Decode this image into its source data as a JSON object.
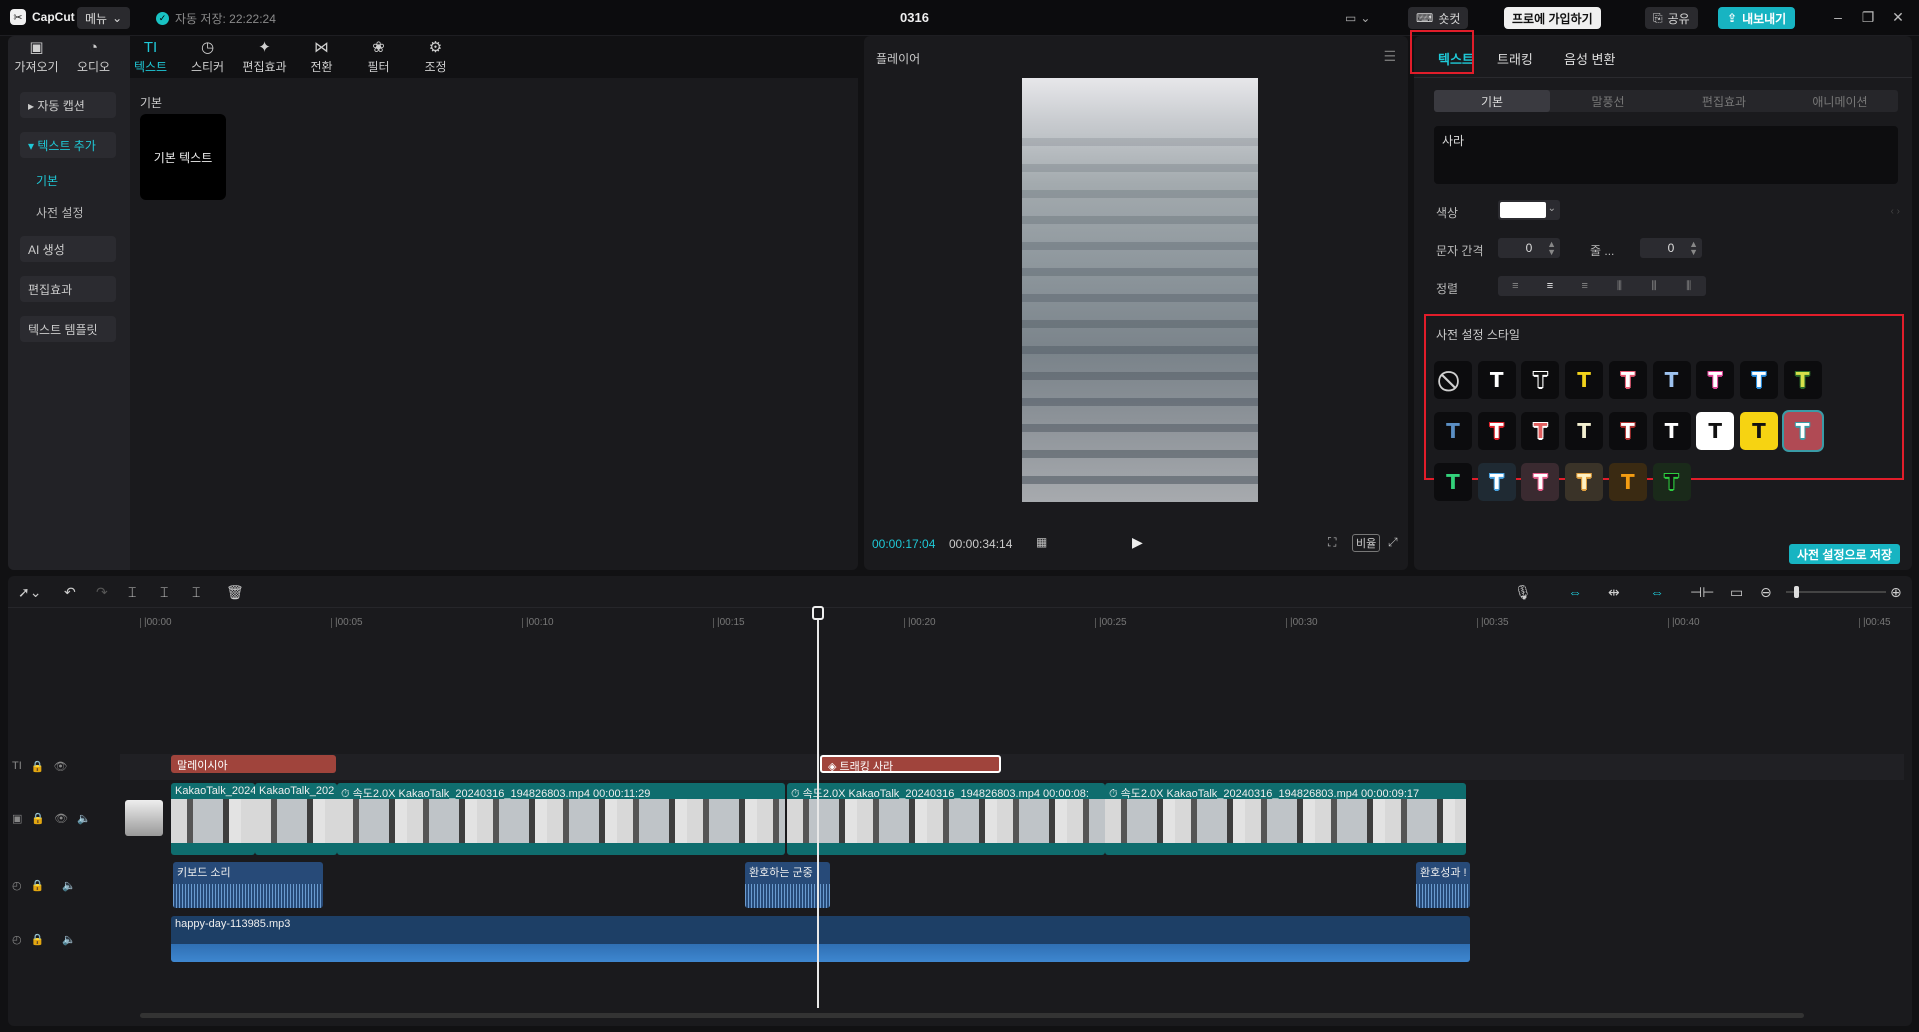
{
  "app": {
    "name": "CapCut",
    "menu_label": "메뉴",
    "autosave": "자동 저장: 22:22:24",
    "project_title": "0316"
  },
  "titlebar": {
    "shortcut": "숏컷",
    "pro": "프로에 가입하기",
    "share": "공유",
    "export": "내보내기"
  },
  "tools": [
    {
      "label": "가져오기",
      "icon": "▣"
    },
    {
      "label": "오디오",
      "icon": "◔"
    },
    {
      "label": "텍스트",
      "icon": "TI"
    },
    {
      "label": "스티커",
      "icon": "◷"
    },
    {
      "label": "편집효과",
      "icon": "✦"
    },
    {
      "label": "전환",
      "icon": "⋈"
    },
    {
      "label": "필터",
      "icon": "❀"
    },
    {
      "label": "조정",
      "icon": "⚙"
    }
  ],
  "leftnav": {
    "auto_caption": "▸ 자동 캡션",
    "add_text": "▾ 텍스트 추가",
    "sub_basic": "기본",
    "sub_preset": "사전 설정",
    "ai_generate": "AI 생성",
    "effects": "편집효과",
    "templates": "텍스트 템플릿"
  },
  "leftpanel": {
    "section": "기본",
    "card": "기본 텍스트"
  },
  "player": {
    "title": "플레이어",
    "time_current": "00:00:17:04",
    "time_total": "00:00:34:14",
    "ratio": "비율"
  },
  "right": {
    "tabs": [
      "텍스트",
      "트래킹",
      "음성 변환"
    ],
    "subtabs": [
      "기본",
      "말풍선",
      "편집효과",
      "애니메이션"
    ],
    "text_value": "사라",
    "color_label": "색상",
    "spacing_label": "문자 간격",
    "spacing_value": "0",
    "line_label": "줄 ...",
    "line_value": "0",
    "align_label": "정렬",
    "presets_title": "사전 설정 스타일",
    "save_preset": "사전 설정으로 저장"
  },
  "presets": [
    {
      "glyph": "⃠",
      "fg": "#d0d0d0",
      "bg": "#0c0c0e"
    },
    {
      "glyph": "T",
      "fg": "#ffffff",
      "bg": "#0c0c0e"
    },
    {
      "glyph": "T",
      "fg": "#111111",
      "bg": "#0c0c0e",
      "outline": "#ffffff"
    },
    {
      "glyph": "T",
      "fg": "#f2d31b",
      "bg": "#0c0c0e"
    },
    {
      "glyph": "T",
      "fg": "#ffffff",
      "bg": "#0c0c0e",
      "outline": "#e85d75"
    },
    {
      "glyph": "T",
      "fg": "#9ec3f0",
      "bg": "#0c0c0e"
    },
    {
      "glyph": "T",
      "fg": "#ffffff",
      "bg": "#0c0c0e",
      "outline": "#e24a9b"
    },
    {
      "glyph": "T",
      "fg": "#ffffff",
      "bg": "#0c0c0e",
      "outline": "#2a8fe0"
    },
    {
      "glyph": "T",
      "fg": "#d6e04a",
      "bg": "#0c0c0e",
      "outline": "#2a6b2a"
    },
    {
      "glyph": "T",
      "fg": "#5b8fc4",
      "bg": "#0c0c0e"
    },
    {
      "glyph": "T",
      "fg": "#ffffff",
      "bg": "#0c0c0e",
      "outline": "#e0202a"
    },
    {
      "glyph": "T",
      "fg": "#e26060",
      "bg": "#0c0c0e",
      "outline": "#ffffff"
    },
    {
      "glyph": "T",
      "fg": "#f3efd0",
      "bg": "#0c0c0e"
    },
    {
      "glyph": "T",
      "fg": "#ffffff",
      "bg": "#0c0c0e",
      "outline": "#b03030"
    },
    {
      "glyph": "T",
      "fg": "#ffffff",
      "bg": "#0c0c0e"
    },
    {
      "glyph": "T",
      "fg": "#111111",
      "bg": "#ffffff"
    },
    {
      "glyph": "T",
      "fg": "#111111",
      "bg": "#f6d312"
    },
    {
      "glyph": "T",
      "fg": "#ffffff",
      "bg": "#b04a54",
      "outline": "#3a9ba6"
    },
    {
      "glyph": "T",
      "fg": "#33d17a",
      "bg": "#0c0c0e"
    },
    {
      "glyph": "T",
      "fg": "#ffffff",
      "bg": "#1f2a33",
      "outline": "#4aa3e0"
    },
    {
      "glyph": "T",
      "fg": "#ffffff",
      "bg": "#3a2a30",
      "outline": "#e65c8a"
    },
    {
      "glyph": "T",
      "fg": "#fff1c2",
      "bg": "#3a3328",
      "outline": "#e0a040"
    },
    {
      "glyph": "T",
      "fg": "#f39c12",
      "bg": "#3a2a12"
    },
    {
      "glyph": "T",
      "fg": "#111111",
      "bg": "#1a2a1a",
      "outline": "#2ecc40"
    }
  ],
  "ruler": [
    "|00:00",
    "|00:05",
    "|00:10",
    "|00:15",
    "|00:20",
    "|00:25",
    "|00:30",
    "|00:35",
    "|00:40",
    "|00:45"
  ],
  "timeline": {
    "text_clips": [
      {
        "label": "말레이시아"
      },
      {
        "label": "◈ 트래킹  사라"
      }
    ],
    "video_clips": [
      {
        "label": "KakaoTalk_2024"
      },
      {
        "label": "KakaoTalk_202"
      },
      {
        "label": "⏱ 속도2.0X  KakaoTalk_20240316_194826803.mp4  00:00:11:29"
      },
      {
        "label": "⏱ 속도2.0X  KakaoTalk_20240316_194826803.mp4  00:00:08:"
      },
      {
        "label": "⏱ 속도2.0X  KakaoTalk_20240316_194826803.mp4  00:00:09:17"
      }
    ],
    "audio_clips": [
      {
        "label": "키보드 소리"
      },
      {
        "label": "환호하는 군중"
      },
      {
        "label": "환호성과 !"
      }
    ],
    "music_clip": {
      "label": "happy-day-113985.mp3"
    },
    "track_icons": [
      "TI",
      "▣",
      "◴",
      "◴"
    ]
  },
  "colors": {
    "accent": "#1fc8d6",
    "highlight_box": "#e11d2a",
    "text_clip": "#a0443c",
    "video_clip": "#0f6d6e",
    "audio_clip": "#274a78"
  }
}
